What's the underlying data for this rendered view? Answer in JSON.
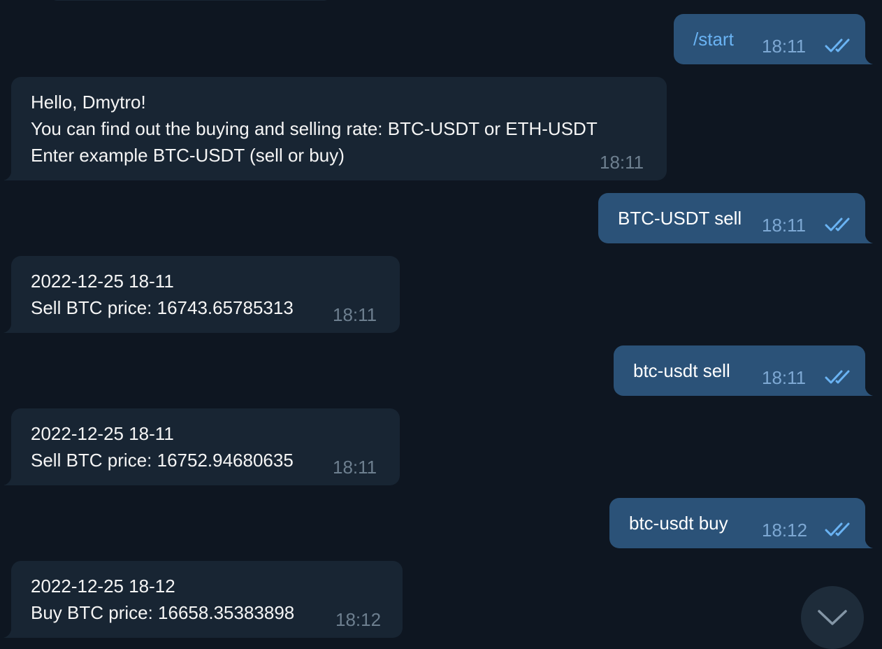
{
  "messages": [
    {
      "direction": "out",
      "text": "/start",
      "time": "18:11",
      "status": "read-double-check-icon"
    },
    {
      "direction": "in",
      "text": "Hello, Dmytro!\nYou can find out the buying and selling rate: BTC-USDT or ETH-USDT\nEnter example BTC-USDT (sell or buy)",
      "time": "18:11"
    },
    {
      "direction": "out",
      "text": "BTC-USDT sell",
      "time": "18:11",
      "status": "read-double-check-icon"
    },
    {
      "direction": "in",
      "text": "2022-12-25 18-11\nSell BTC price: 16743.65785313",
      "time": "18:11"
    },
    {
      "direction": "out",
      "text": "btc-usdt sell",
      "time": "18:11",
      "status": "read-double-check-icon"
    },
    {
      "direction": "in",
      "text": "2022-12-25 18-11\nSell BTC price: 16752.94680635",
      "time": "18:11"
    },
    {
      "direction": "out",
      "text": "btc-usdt buy",
      "time": "18:12",
      "status": "read-double-check-icon"
    },
    {
      "direction": "in",
      "text": "2022-12-25 18-12\nBuy BTC price: 16658.35383898",
      "time": "18:12"
    }
  ],
  "scroll_down_button": {
    "icon": "chevron-down-icon"
  },
  "colors": {
    "background": "#0e1621",
    "incoming_bubble": "#182533",
    "outgoing_bubble": "#2b5278",
    "command_link": "#6ab3f3",
    "read_check": "#6ab3f3"
  }
}
